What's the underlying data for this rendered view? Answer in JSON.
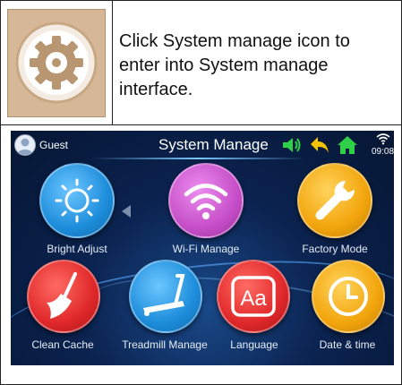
{
  "instruction": "Click System manage icon to enter into System manage interface.",
  "screen": {
    "user": "Guest",
    "title": "System Manage",
    "time": "09:08",
    "apps": [
      {
        "label": "Bright Adjust",
        "icon": "sun-icon",
        "color": "#2aa0e8"
      },
      {
        "label": "Wi-Fi Manage",
        "icon": "wifi-icon",
        "color": "#c64fc8"
      },
      {
        "label": "Factory Mode",
        "icon": "wrench-icon",
        "color": "#f2a50c"
      },
      {
        "label": "Clean Cache",
        "icon": "broom-icon",
        "color": "#e0282a"
      },
      {
        "label": "Treadmill Manage",
        "icon": "treadmill-icon",
        "color": "#2aa0e8"
      },
      {
        "label": "Language",
        "icon": "language-icon",
        "color": "#e0282a"
      },
      {
        "label": "Date & time",
        "icon": "clock-icon",
        "color": "#f2a50c"
      }
    ]
  },
  "colors": {
    "volume": "#2fcf4a",
    "back": "#f5c400",
    "home": "#2fcf4a"
  }
}
